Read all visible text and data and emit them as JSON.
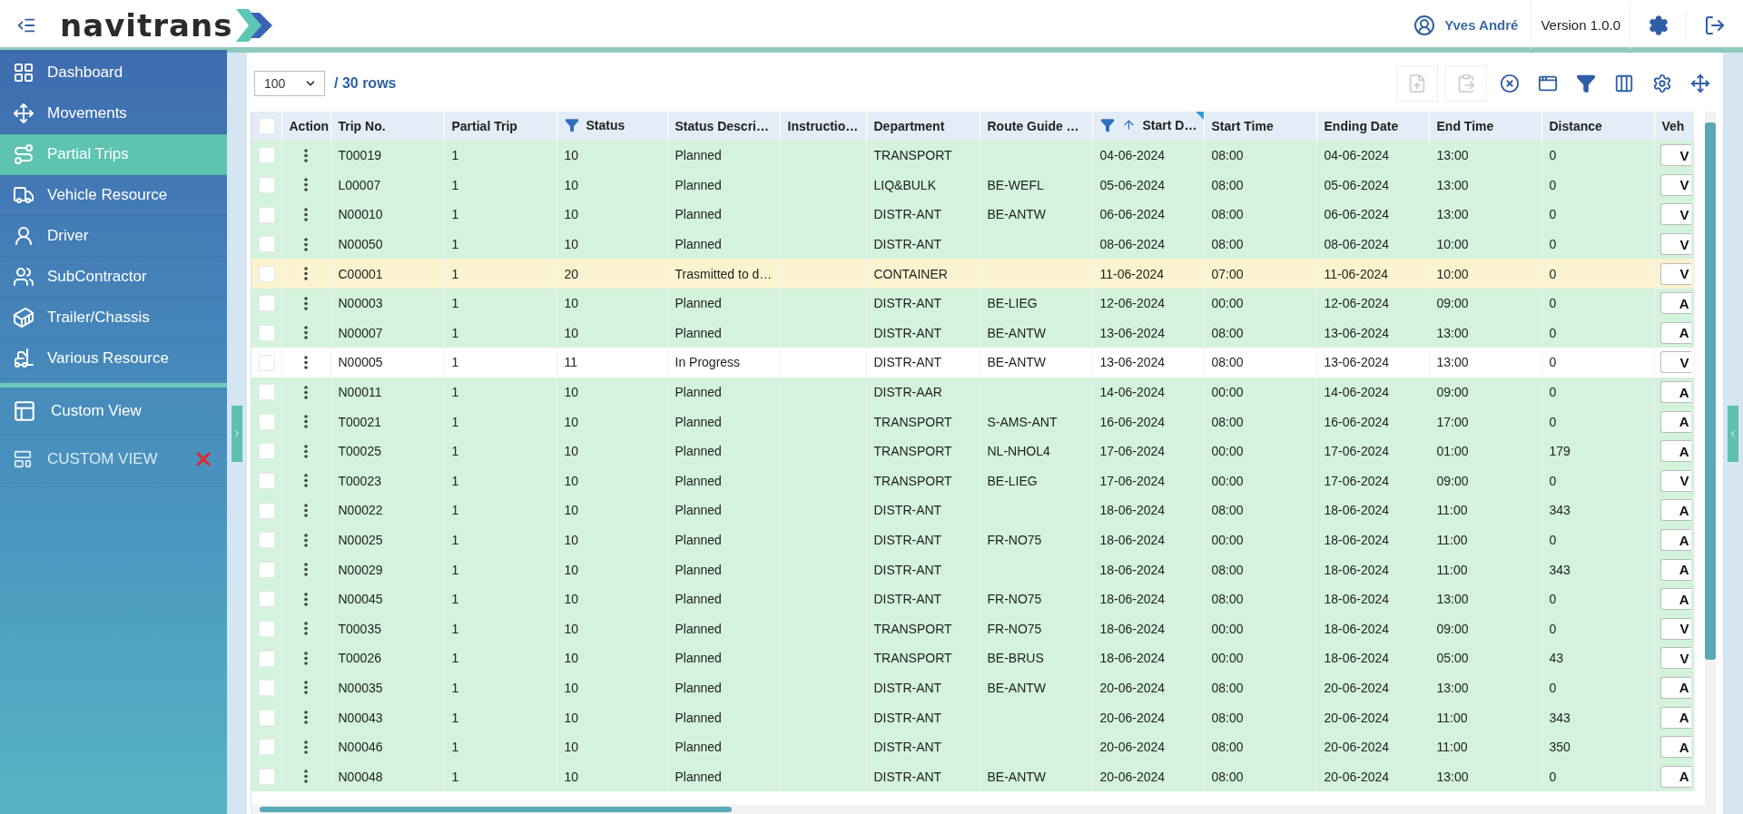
{
  "header": {
    "brand": "navitrans",
    "user": "Yves André",
    "version": "Version 1.0.0"
  },
  "sidebar": {
    "items": [
      {
        "label": "Dashboard",
        "selected": false
      },
      {
        "label": "Movements",
        "selected": false
      },
      {
        "label": "Partial Trips",
        "selected": true
      },
      {
        "label": "Vehicle Resource",
        "selected": false
      },
      {
        "label": "Driver",
        "selected": false
      },
      {
        "label": "SubContractor",
        "selected": false
      },
      {
        "label": "Trailer/Chassis",
        "selected": false
      },
      {
        "label": "Various Resource",
        "selected": false
      }
    ],
    "custom_view_button": "Custom View",
    "saved_views": [
      {
        "label": "CUSTOM VIEW"
      }
    ]
  },
  "toolbar": {
    "page_size": "100",
    "row_count": "/ 30 rows",
    "buttons": [
      {
        "kind": "export",
        "disabled": true
      },
      {
        "kind": "clipboard",
        "disabled": true
      },
      {
        "kind": "clear",
        "disabled": false
      },
      {
        "kind": "layout",
        "disabled": false
      },
      {
        "kind": "filter",
        "disabled": false
      },
      {
        "kind": "columns",
        "disabled": false
      },
      {
        "kind": "settings",
        "disabled": false
      },
      {
        "kind": "move",
        "disabled": false
      }
    ]
  },
  "table": {
    "select_all": {
      "checked": false
    },
    "columns": [
      {
        "label": "Action",
        "filtered": false,
        "sorted": false
      },
      {
        "label": "Trip No.",
        "filtered": false,
        "sorted": false
      },
      {
        "label": "Partial Trip",
        "filtered": false,
        "sorted": false
      },
      {
        "label": "Status",
        "filtered": true,
        "sorted": false
      },
      {
        "label": "Status Descri…",
        "filtered": false,
        "sorted": false
      },
      {
        "label": "Instructio…",
        "filtered": false,
        "sorted": false
      },
      {
        "label": "Department",
        "filtered": false,
        "sorted": false
      },
      {
        "label": "Route Guide …",
        "filtered": false,
        "sorted": false
      },
      {
        "label": "Start D…",
        "filtered": true,
        "sorted": true
      },
      {
        "label": "Start Time",
        "filtered": false,
        "sorted": false
      },
      {
        "label": "Ending Date",
        "filtered": false,
        "sorted": false
      },
      {
        "label": "End Time",
        "filtered": false,
        "sorted": false
      },
      {
        "label": "Distance",
        "filtered": false,
        "sorted": false
      },
      {
        "label": "Veh",
        "filtered": false,
        "sorted": false
      }
    ],
    "rows": [
      {
        "checked": false,
        "color": "#d3f3dc",
        "trip_no": "T00019",
        "partial_trip": "1",
        "status": "10",
        "status_description": "Planned",
        "department": "TRANSPORT",
        "start_date": "04-06-2024",
        "start_time": "08:00",
        "ending_date": "04-06-2024",
        "end_time": "13:00",
        "distance": "0",
        "vehicle": "V"
      },
      {
        "checked": false,
        "color": "#d3f3dc",
        "trip_no": "L00007",
        "partial_trip": "1",
        "status": "10",
        "status_description": "Planned",
        "department": "LIQ&BULK",
        "route_guide": "BE-WEFL",
        "start_date": "05-06-2024",
        "start_time": "08:00",
        "ending_date": "05-06-2024",
        "end_time": "13:00",
        "distance": "0",
        "vehicle": "V"
      },
      {
        "checked": false,
        "color": "#d3f3dc",
        "trip_no": "N00010",
        "partial_trip": "1",
        "status": "10",
        "status_description": "Planned",
        "department": "DISTR-ANT",
        "route_guide": "BE-ANTW",
        "start_date": "06-06-2024",
        "start_time": "08:00",
        "ending_date": "06-06-2024",
        "end_time": "13:00",
        "distance": "0",
        "vehicle": "V"
      },
      {
        "checked": false,
        "color": "#d3f3dc",
        "trip_no": "N00050",
        "partial_trip": "1",
        "status": "10",
        "status_description": "Planned",
        "department": "DISTR-ANT",
        "start_date": "08-06-2024",
        "start_time": "08:00",
        "ending_date": "08-06-2024",
        "end_time": "10:00",
        "distance": "0",
        "vehicle": "V"
      },
      {
        "checked": false,
        "color": "#fbf3cf",
        "trip_no": "C00001",
        "partial_trip": "1",
        "status": "20",
        "status_description": "Trasmitted to d…",
        "department": "CONTAINER",
        "start_date": "11-06-2024",
        "start_time": "07:00",
        "ending_date": "11-06-2024",
        "end_time": "10:00",
        "distance": "0",
        "vehicle": "V"
      },
      {
        "checked": false,
        "color": "#d3f3dc",
        "trip_no": "N00003",
        "partial_trip": "1",
        "status": "10",
        "status_description": "Planned",
        "department": "DISTR-ANT",
        "route_guide": "BE-LIEG",
        "start_date": "12-06-2024",
        "start_time": "00:00",
        "ending_date": "12-06-2024",
        "end_time": "09:00",
        "distance": "0",
        "vehicle": "A"
      },
      {
        "checked": false,
        "color": "#d3f3dc",
        "trip_no": "N00007",
        "partial_trip": "1",
        "status": "10",
        "status_description": "Planned",
        "department": "DISTR-ANT",
        "route_guide": "BE-ANTW",
        "start_date": "13-06-2024",
        "start_time": "08:00",
        "ending_date": "13-06-2024",
        "end_time": "13:00",
        "distance": "0",
        "vehicle": "A"
      },
      {
        "checked": false,
        "color": "#ffffff",
        "trip_no": "N00005",
        "partial_trip": "1",
        "status": "11",
        "status_description": "In Progress",
        "department": "DISTR-ANT",
        "route_guide": "BE-ANTW",
        "start_date": "13-06-2024",
        "start_time": "08:00",
        "ending_date": "13-06-2024",
        "end_time": "13:00",
        "distance": "0",
        "vehicle": "V"
      },
      {
        "checked": false,
        "color": "#d3f3dc",
        "trip_no": "N00011",
        "partial_trip": "1",
        "status": "10",
        "status_description": "Planned",
        "department": "DISTR-AAR",
        "start_date": "14-06-2024",
        "start_time": "00:00",
        "ending_date": "14-06-2024",
        "end_time": "09:00",
        "distance": "0",
        "vehicle": "A"
      },
      {
        "checked": false,
        "color": "#d3f3dc",
        "trip_no": "T00021",
        "partial_trip": "1",
        "status": "10",
        "status_description": "Planned",
        "department": "TRANSPORT",
        "route_guide": "S-AMS-ANT",
        "start_date": "16-06-2024",
        "start_time": "08:00",
        "ending_date": "16-06-2024",
        "end_time": "17:00",
        "distance": "0",
        "vehicle": "A"
      },
      {
        "checked": false,
        "color": "#d3f3dc",
        "trip_no": "T00025",
        "partial_trip": "1",
        "status": "10",
        "status_description": "Planned",
        "department": "TRANSPORT",
        "route_guide": "NL-NHOL4",
        "start_date": "17-06-2024",
        "start_time": "00:00",
        "ending_date": "17-06-2024",
        "end_time": "01:00",
        "distance": "179",
        "vehicle": "A"
      },
      {
        "checked": false,
        "color": "#d3f3dc",
        "trip_no": "T00023",
        "partial_trip": "1",
        "status": "10",
        "status_description": "Planned",
        "department": "TRANSPORT",
        "route_guide": "BE-LIEG",
        "start_date": "17-06-2024",
        "start_time": "00:00",
        "ending_date": "17-06-2024",
        "end_time": "09:00",
        "distance": "0",
        "vehicle": "V"
      },
      {
        "checked": false,
        "color": "#d3f3dc",
        "trip_no": "N00022",
        "partial_trip": "1",
        "status": "10",
        "status_description": "Planned",
        "department": "DISTR-ANT",
        "start_date": "18-06-2024",
        "start_time": "08:00",
        "ending_date": "18-06-2024",
        "end_time": "11:00",
        "distance": "343",
        "vehicle": "A"
      },
      {
        "checked": false,
        "color": "#d3f3dc",
        "trip_no": "N00025",
        "partial_trip": "1",
        "status": "10",
        "status_description": "Planned",
        "department": "DISTR-ANT",
        "route_guide": "FR-NO75",
        "start_date": "18-06-2024",
        "start_time": "00:00",
        "ending_date": "18-06-2024",
        "end_time": "11:00",
        "distance": "0",
        "vehicle": "A"
      },
      {
        "checked": false,
        "color": "#d3f3dc",
        "trip_no": "N00029",
        "partial_trip": "1",
        "status": "10",
        "status_description": "Planned",
        "department": "DISTR-ANT",
        "start_date": "18-06-2024",
        "start_time": "08:00",
        "ending_date": "18-06-2024",
        "end_time": "11:00",
        "distance": "343",
        "vehicle": "A"
      },
      {
        "checked": false,
        "color": "#d3f3dc",
        "trip_no": "N00045",
        "partial_trip": "1",
        "status": "10",
        "status_description": "Planned",
        "department": "DISTR-ANT",
        "route_guide": "FR-NO75",
        "start_date": "18-06-2024",
        "start_time": "08:00",
        "ending_date": "18-06-2024",
        "end_time": "13:00",
        "distance": "0",
        "vehicle": "A"
      },
      {
        "checked": false,
        "color": "#d3f3dc",
        "trip_no": "T00035",
        "partial_trip": "1",
        "status": "10",
        "status_description": "Planned",
        "department": "TRANSPORT",
        "route_guide": "FR-NO75",
        "start_date": "18-06-2024",
        "start_time": "00:00",
        "ending_date": "18-06-2024",
        "end_time": "09:00",
        "distance": "0",
        "vehicle": "V"
      },
      {
        "checked": false,
        "color": "#d3f3dc",
        "trip_no": "T00026",
        "partial_trip": "1",
        "status": "10",
        "status_description": "Planned",
        "department": "TRANSPORT",
        "route_guide": "BE-BRUS",
        "start_date": "18-06-2024",
        "start_time": "00:00",
        "ending_date": "18-06-2024",
        "end_time": "05:00",
        "distance": "43",
        "vehicle": "V"
      },
      {
        "checked": false,
        "color": "#d3f3dc",
        "trip_no": "N00035",
        "partial_trip": "1",
        "status": "10",
        "status_description": "Planned",
        "department": "DISTR-ANT",
        "route_guide": "BE-ANTW",
        "start_date": "20-06-2024",
        "start_time": "08:00",
        "ending_date": "20-06-2024",
        "end_time": "13:00",
        "distance": "0",
        "vehicle": "A"
      },
      {
        "checked": false,
        "color": "#d3f3dc",
        "trip_no": "N00043",
        "partial_trip": "1",
        "status": "10",
        "status_description": "Planned",
        "department": "DISTR-ANT",
        "start_date": "20-06-2024",
        "start_time": "08:00",
        "ending_date": "20-06-2024",
        "end_time": "11:00",
        "distance": "343",
        "vehicle": "A"
      },
      {
        "checked": false,
        "color": "#d3f3dc",
        "trip_no": "N00046",
        "partial_trip": "1",
        "status": "10",
        "status_description": "Planned",
        "department": "DISTR-ANT",
        "start_date": "20-06-2024",
        "start_time": "08:00",
        "ending_date": "20-06-2024",
        "end_time": "11:00",
        "distance": "350",
        "vehicle": "A"
      },
      {
        "checked": false,
        "color": "#d3f3dc",
        "trip_no": "N00048",
        "partial_trip": "1",
        "status": "10",
        "status_description": "Planned",
        "department": "DISTR-ANT",
        "route_guide": "BE-ANTW",
        "start_date": "20-06-2024",
        "start_time": "08:00",
        "ending_date": "20-06-2024",
        "end_time": "13:00",
        "distance": "0",
        "vehicle": "A"
      }
    ]
  }
}
